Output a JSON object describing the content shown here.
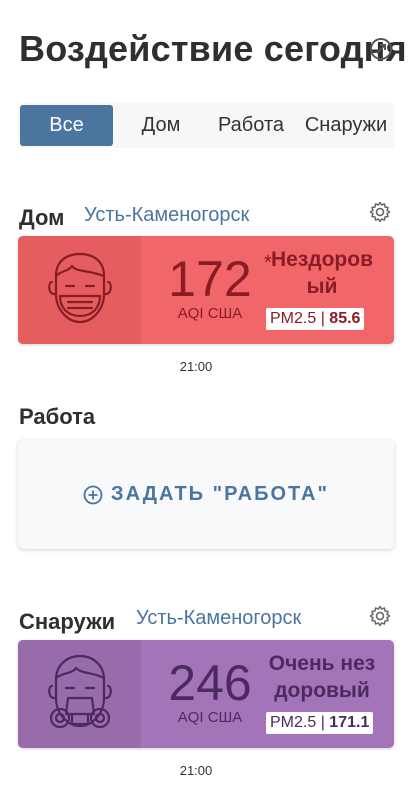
{
  "header": {
    "title": "Воздействие сегодня"
  },
  "tabs": [
    {
      "label": "Все",
      "active": true
    },
    {
      "label": "Дом",
      "active": false
    },
    {
      "label": "Работа",
      "active": false
    },
    {
      "label": "Снаружи",
      "active": false
    }
  ],
  "home": {
    "label": "Дом",
    "city": "Усть-Каменогорск",
    "aqi": "172",
    "asterisk": "*",
    "aqi_label": "AQI США",
    "status": "Нездоровый",
    "pm_label": "PM2.5 | ",
    "pm_value": "85.6",
    "time": "21:00",
    "color": "#f16769",
    "face_color": "#e55d5f",
    "text_color": "#8a1c26"
  },
  "work": {
    "label": "Работа",
    "add_text": "ЗАДАТЬ \"РАБОТА\""
  },
  "outside": {
    "label": "Снаружи",
    "city": "Усть-Каменогорск",
    "aqi": "246",
    "aqi_label": "AQI США",
    "status": "Очень нездоровый",
    "pm_label": "PM2.5 | ",
    "pm_value": "171.1",
    "time": "21:00",
    "color": "#a474b8",
    "face_color": "#986bab",
    "text_color": "#4d2a5e"
  },
  "icons": {
    "title_icon": "circle-arrow-icon",
    "home_face": "face-mask-icon",
    "outside_face": "respirator-mask-icon",
    "gear": "gear-icon",
    "add": "plus-circle-icon"
  }
}
